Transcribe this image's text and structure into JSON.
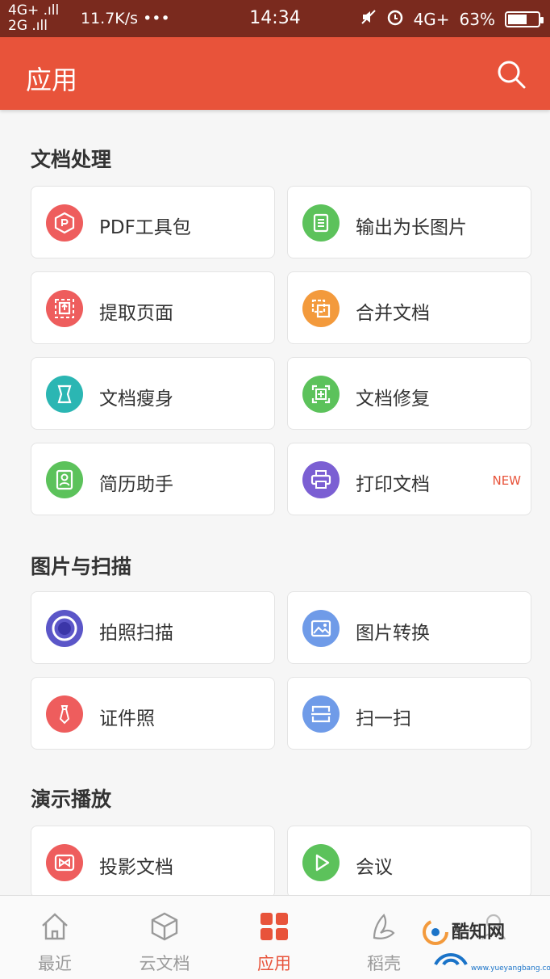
{
  "status_bar": {
    "network_top": "4G+ .ıll",
    "network_bottom": "2G .ıll",
    "speed": "11.7K/s •••",
    "time": "14:34",
    "network_right": "4G+",
    "battery": "63%",
    "battery_level": 0.63
  },
  "app_bar": {
    "title": "应用",
    "search_icon": "search-icon"
  },
  "sections": [
    {
      "title": "文档处理",
      "items": [
        {
          "label": "PDF工具包",
          "icon": "pdf-toolkit-icon",
          "color": "#ee5d5d"
        },
        {
          "label": "输出为长图片",
          "icon": "long-image-icon",
          "color": "#5cc25b"
        },
        {
          "label": "提取页面",
          "icon": "extract-page-icon",
          "color": "#ee5d5d"
        },
        {
          "label": "合并文档",
          "icon": "merge-docs-icon",
          "color": "#f39a3c"
        },
        {
          "label": "文档瘦身",
          "icon": "slim-doc-icon",
          "color": "#2bb6b3"
        },
        {
          "label": "文档修复",
          "icon": "repair-doc-icon",
          "color": "#5cc25b"
        },
        {
          "label": "简历助手",
          "icon": "resume-icon",
          "color": "#5cc25b"
        },
        {
          "label": "打印文档",
          "icon": "print-icon",
          "color": "#7b5fd3",
          "badge": "NEW"
        }
      ]
    },
    {
      "title": "图片与扫描",
      "items": [
        {
          "label": "拍照扫描",
          "icon": "camera-scan-icon",
          "color": "#5b56c8"
        },
        {
          "label": "图片转换",
          "icon": "image-convert-icon",
          "color": "#6f9be8"
        },
        {
          "label": "证件照",
          "icon": "id-photo-icon",
          "color": "#ee5d5d"
        },
        {
          "label": "扫一扫",
          "icon": "scan-icon",
          "color": "#6f9be8"
        }
      ]
    },
    {
      "title": "演示播放",
      "items": [
        {
          "label": "投影文档",
          "icon": "projection-icon",
          "color": "#ee5d5d"
        },
        {
          "label": "会议",
          "icon": "meeting-icon",
          "color": "#5cc25b"
        }
      ]
    }
  ],
  "bottom_nav": [
    {
      "label": "最近",
      "icon": "home-icon",
      "active": false
    },
    {
      "label": "云文档",
      "icon": "cloud-doc-icon",
      "active": false
    },
    {
      "label": "应用",
      "icon": "apps-grid-icon",
      "active": true
    },
    {
      "label": "稻壳",
      "icon": "shell-icon",
      "active": false
    },
    {
      "label": "",
      "icon": "me-icon",
      "active": false
    }
  ],
  "watermark": {
    "title": "酷知网",
    "subtitle": "www.yueyangbang.com"
  },
  "colors": {
    "accent": "#e8533a",
    "status_bar": "#7a2a1e",
    "background": "#f6f6f6"
  }
}
